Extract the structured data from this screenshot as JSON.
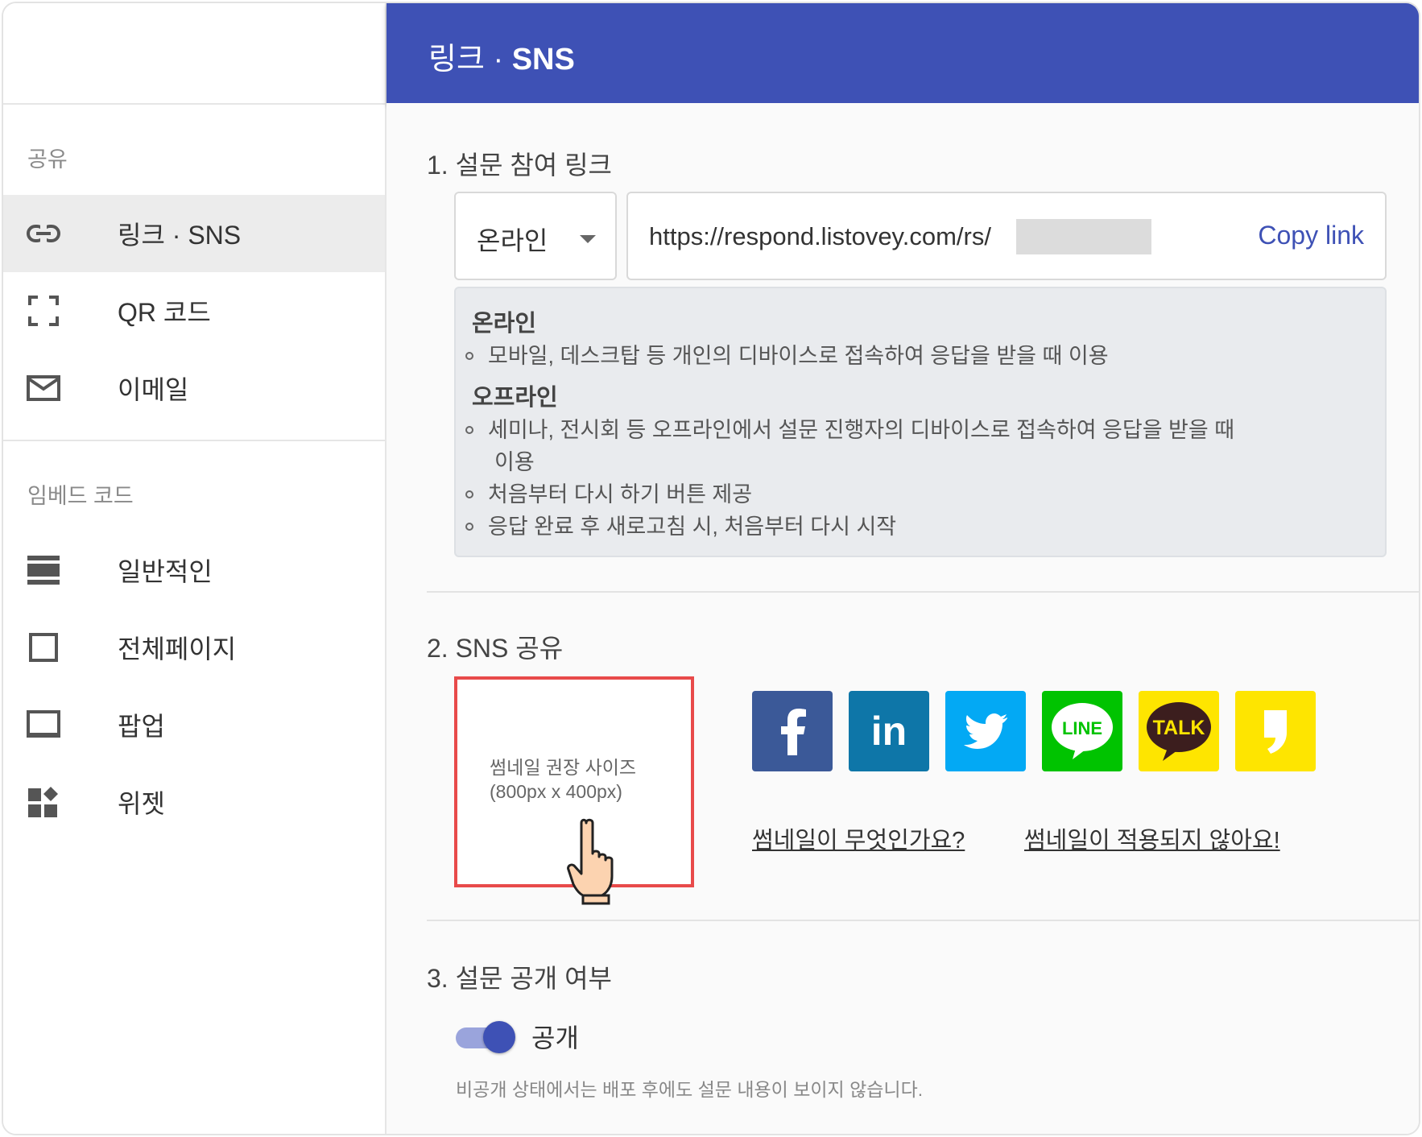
{
  "header": {
    "title_prefix": "링크 · ",
    "title_bold": "SNS"
  },
  "sidebar": {
    "share_title": "공유",
    "share_items": [
      {
        "label": "링크 · SNS",
        "icon": "link-icon",
        "active": true
      },
      {
        "label": "QR 코드",
        "icon": "qr-frame-icon"
      },
      {
        "label": "이메일",
        "icon": "mail-icon"
      }
    ],
    "embed_title": "임베드 코드",
    "embed_items": [
      {
        "label": "일반적인",
        "icon": "lines-icon"
      },
      {
        "label": "전체페이지",
        "icon": "square-icon"
      },
      {
        "label": "팝업",
        "icon": "popup-icon"
      },
      {
        "label": "위젯",
        "icon": "widget-icon"
      }
    ]
  },
  "section1": {
    "title": "1. 설문 참여 링크",
    "select_value": "온라인",
    "url": "https://respond.listovey.com/rs/",
    "copy_label": "Copy link",
    "info": {
      "online_title": "온라인",
      "online_items": [
        "모바일, 데스크탑 등 개인의 디바이스로 접속하여 응답을 받을 때 이용"
      ],
      "offline_title": "오프라인",
      "offline_item1_a": "세미나, 전시회 등 오프라인에서 설문 진행자의 디바이스로 접속하여 응답을 받을 때",
      "offline_item1_b": "이용",
      "offline_item2": "처음부터 다시 하기 버튼 제공",
      "offline_item3": "응답 완료 후 새로고침 시, 처음부터 다시 시작"
    }
  },
  "section2": {
    "title": "2. SNS 공유",
    "thumb_line1": "썸네일 권장 사이즈",
    "thumb_line2": "(800px x 400px)",
    "sns": [
      {
        "name": "facebook",
        "icon": "facebook-icon",
        "text": "f"
      },
      {
        "name": "linkedin",
        "icon": "linkedin-icon",
        "text": "in"
      },
      {
        "name": "twitter",
        "icon": "twitter-icon"
      },
      {
        "name": "line",
        "icon": "line-icon",
        "text": "LINE"
      },
      {
        "name": "kakaotalk",
        "icon": "kakaotalk-icon",
        "text": "TALK"
      },
      {
        "name": "kakaostory",
        "icon": "kakaostory-icon"
      }
    ],
    "link_what": "썸네일이 무엇인가요?",
    "link_not_applied": "썸네일이 적용되지 않아요!",
    "colors": {
      "facebook": "#3b5998",
      "linkedin": "#0e76a8",
      "twitter": "#03a9f4",
      "line": "#00c300",
      "kakao": "#fee500"
    }
  },
  "section3": {
    "title": "3. 설문 공개 여부",
    "toggle_label": "공개",
    "toggle_on": true,
    "note": "비공개 상태에서는 배포 후에도 설문 내용이 보이지 않습니다."
  },
  "theme": {
    "accent": "#3e51b5",
    "thumb_border": "#e84a4a"
  }
}
